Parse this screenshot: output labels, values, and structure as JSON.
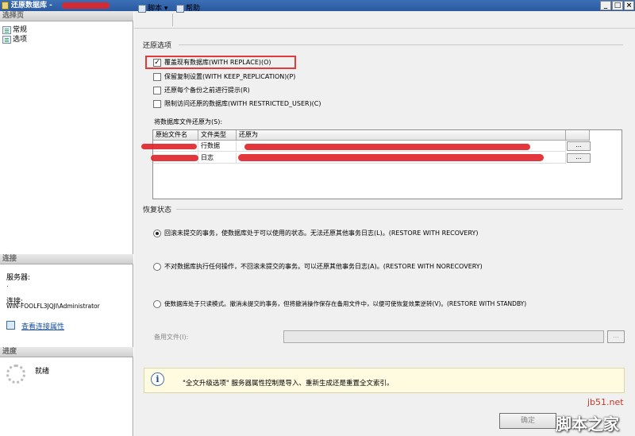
{
  "window": {
    "title": "还原数据库 -",
    "min": "_",
    "max": "□",
    "close": "×"
  },
  "left": {
    "select_page_header": "选择页",
    "nav": [
      {
        "label": "常规"
      },
      {
        "label": "选项"
      }
    ],
    "connection_header": "连接",
    "server_label": "服务器:",
    "server_value": ".",
    "connection_label": "连接:",
    "connection_value": "WIN-FOOLFL3JQJI\\Administrator",
    "view_props_link": "查看连接属性",
    "progress_header": "进度",
    "progress_status": "就绪"
  },
  "toolbar": {
    "script": "脚本",
    "script_arrow": "▾",
    "help": "帮助"
  },
  "restore_options": {
    "group_label": "还原选项",
    "checkboxes": [
      {
        "label": "覆盖现有数据库(WITH REPLACE)(O)",
        "checked": true
      },
      {
        "label": "保留复制设置(WITH KEEP_REPLICATION)(P)",
        "checked": false
      },
      {
        "label": "还原每个备份之前进行提示(R)",
        "checked": false
      },
      {
        "label": "限制访问还原的数据库(WITH RESTRICTED_USER)(C)",
        "checked": false
      }
    ],
    "check_mark": "✓",
    "files_label": "将数据库文件还原为(S):",
    "columns": [
      "原始文件名",
      "文件类型",
      "还原为"
    ],
    "rows": [
      {
        "type": "行数据"
      },
      {
        "type": "日志"
      }
    ],
    "ellipsis": "..."
  },
  "recovery": {
    "group_label": "恢复状态",
    "options": [
      {
        "label": "回滚未提交的事务，使数据库处于可以使用的状态。无法还原其他事务日志(L)。(RESTORE WITH RECOVERY)",
        "selected": true
      },
      {
        "label": "不对数据库执行任何操作，不回滚未提交的事务。可以还原其他事务日志(A)。(RESTORE WITH NORECOVERY)",
        "selected": false
      },
      {
        "label": "使数据库处于只读模式。撤消未提交的事务，但将撤消操作保存在备用文件中，以便可使恢复效果逆转(V)。(RESTORE WITH STANDBY)",
        "selected": false
      }
    ],
    "standby_label": "备用文件(I):",
    "standby_value": "",
    "ellipsis": "..."
  },
  "info": {
    "icon": "i",
    "text": "\"全文升级选项\" 服务器属性控制是导入、重新生成还是重置全文索引。"
  },
  "buttons": {
    "ok": "确定"
  },
  "watermark": {
    "url": "jb51.net",
    "name": "脚本之家"
  }
}
